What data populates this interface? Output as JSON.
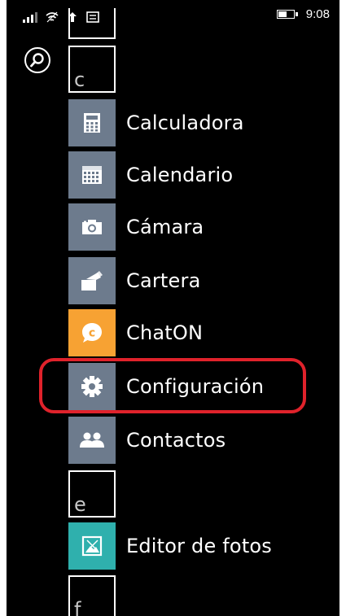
{
  "status_bar": {
    "time": "9:08",
    "battery_level": 0.6,
    "icons": [
      "signal-icon",
      "wifi-icon",
      "data-icon",
      "message-icon"
    ]
  },
  "search": {
    "icon": "search-icon"
  },
  "letters": {
    "c": "c",
    "e": "e",
    "f": "f"
  },
  "apps": [
    {
      "label": "Calculadora",
      "icon": "calculator-icon",
      "color": "#6d7b8d"
    },
    {
      "label": "Calendario",
      "icon": "calendar-icon",
      "color": "#6d7b8d"
    },
    {
      "label": "Cámara",
      "icon": "camera-icon",
      "color": "#6d7b8d"
    },
    {
      "label": "Cartera",
      "icon": "wallet-icon",
      "color": "#6d7b8d"
    },
    {
      "label": "ChatON",
      "icon": "chaton-icon",
      "color": "#f7a233"
    },
    {
      "label": "Configuración",
      "icon": "gear-icon",
      "color": "#6d7b8d"
    },
    {
      "label": "Contactos",
      "icon": "people-icon",
      "color": "#6d7b8d"
    },
    {
      "label": "Editor de fotos",
      "icon": "photo-editor-icon",
      "color": "#2fb0ad"
    }
  ],
  "highlight_color": "#e0222b"
}
